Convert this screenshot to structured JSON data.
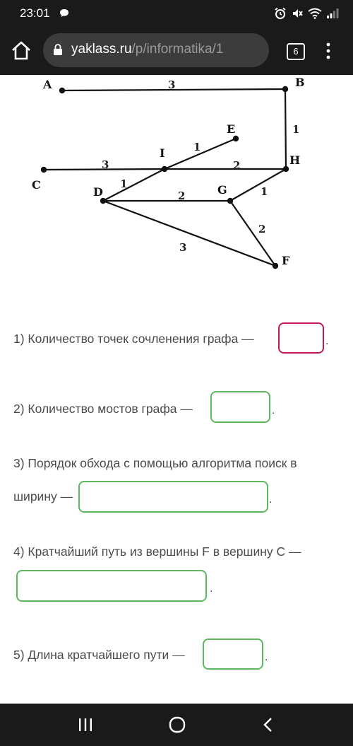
{
  "status_bar": {
    "time": "23:01",
    "icons": [
      "chat-bubble-icon",
      "alarm-icon",
      "mute-icon",
      "wifi-icon",
      "signal-icon"
    ]
  },
  "browser": {
    "url_host": "yaklass.ru",
    "url_path": "/p/informatika/1",
    "tab_count": "6"
  },
  "graph": {
    "vertices": [
      "A",
      "B",
      "C",
      "D",
      "E",
      "F",
      "G",
      "H",
      "I"
    ],
    "edges": [
      {
        "from": "A",
        "to": "B",
        "weight": "3"
      },
      {
        "from": "B",
        "to": "H",
        "weight": "1"
      },
      {
        "from": "C",
        "to": "I",
        "weight": "3"
      },
      {
        "from": "I",
        "to": "H",
        "weight": "2"
      },
      {
        "from": "I",
        "to": "E",
        "weight": "1"
      },
      {
        "from": "D",
        "to": "I",
        "weight": "1"
      },
      {
        "from": "D",
        "to": "G",
        "weight": "2"
      },
      {
        "from": "G",
        "to": "H",
        "weight": "1"
      },
      {
        "from": "G",
        "to": "F",
        "weight": "2"
      },
      {
        "from": "D",
        "to": "F",
        "weight": "3"
      }
    ]
  },
  "questions": {
    "q1": "1) Количество точек сочленения графа —",
    "q2": "2) Количество мостов графа —",
    "q3_line1": "3) Порядок обхода с помощью алгоритма поиск в",
    "q3_line2": "ширину —",
    "q4": "4) Кратчайший путь из вершины F в вершину C —",
    "q5": "5) Длина кратчайшего пути —",
    "period": "."
  },
  "answers": {
    "a1": "",
    "a2": "",
    "a3": "",
    "a4": "",
    "a5": ""
  },
  "colors": {
    "active_border": "#c2185b",
    "filled_border": "#5cb85c",
    "bar_background": "#1a1a1a"
  }
}
